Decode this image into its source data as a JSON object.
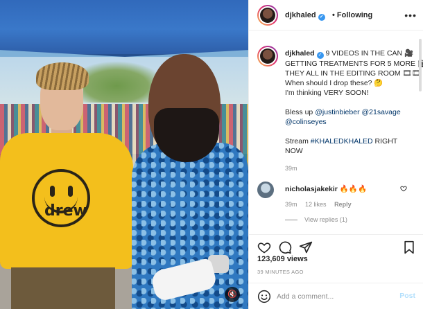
{
  "header": {
    "username": "djkhaled",
    "separator": "•",
    "follow_status": "Following",
    "more_label": "•••"
  },
  "caption": {
    "username": "djkhaled",
    "lines": [
      "9 VIDEOS IN THE CAN 🎥",
      "GETTING TREATMENTS FOR 5 MORE 🎬",
      "THEY ALL IN THE EDITING ROOM 🎞🎞",
      "When should I drop these? 🤔",
      "I'm thinking VERY SOON!"
    ],
    "bless_prefix": "Bless up ",
    "mention_1": "@justinbieber",
    "mention_2": "@21savage",
    "mention_3": "@colinseyes",
    "stream_prefix": "Stream ",
    "hashtag": "#KHALEDKHALED",
    "stream_suffix": " RIGHT",
    "stream_line2": "NOW",
    "time": "39m"
  },
  "comment": {
    "username": "nicholasjakekir",
    "text": "🔥🔥🔥",
    "time": "39m",
    "likes": "12 likes",
    "reply": "Reply",
    "view_replies": "View replies (1)"
  },
  "post": {
    "likes": "123,609 views",
    "ago": "39 MINUTES AGO"
  },
  "add_comment": {
    "placeholder": "Add a comment...",
    "post_label": "Post"
  },
  "media": {
    "shirt_text": "drew",
    "mute_icon": "🔇"
  },
  "colors": {
    "accent": "#3897f0",
    "post_disabled": "#b2dffc",
    "muted": "#8e8e8e"
  }
}
